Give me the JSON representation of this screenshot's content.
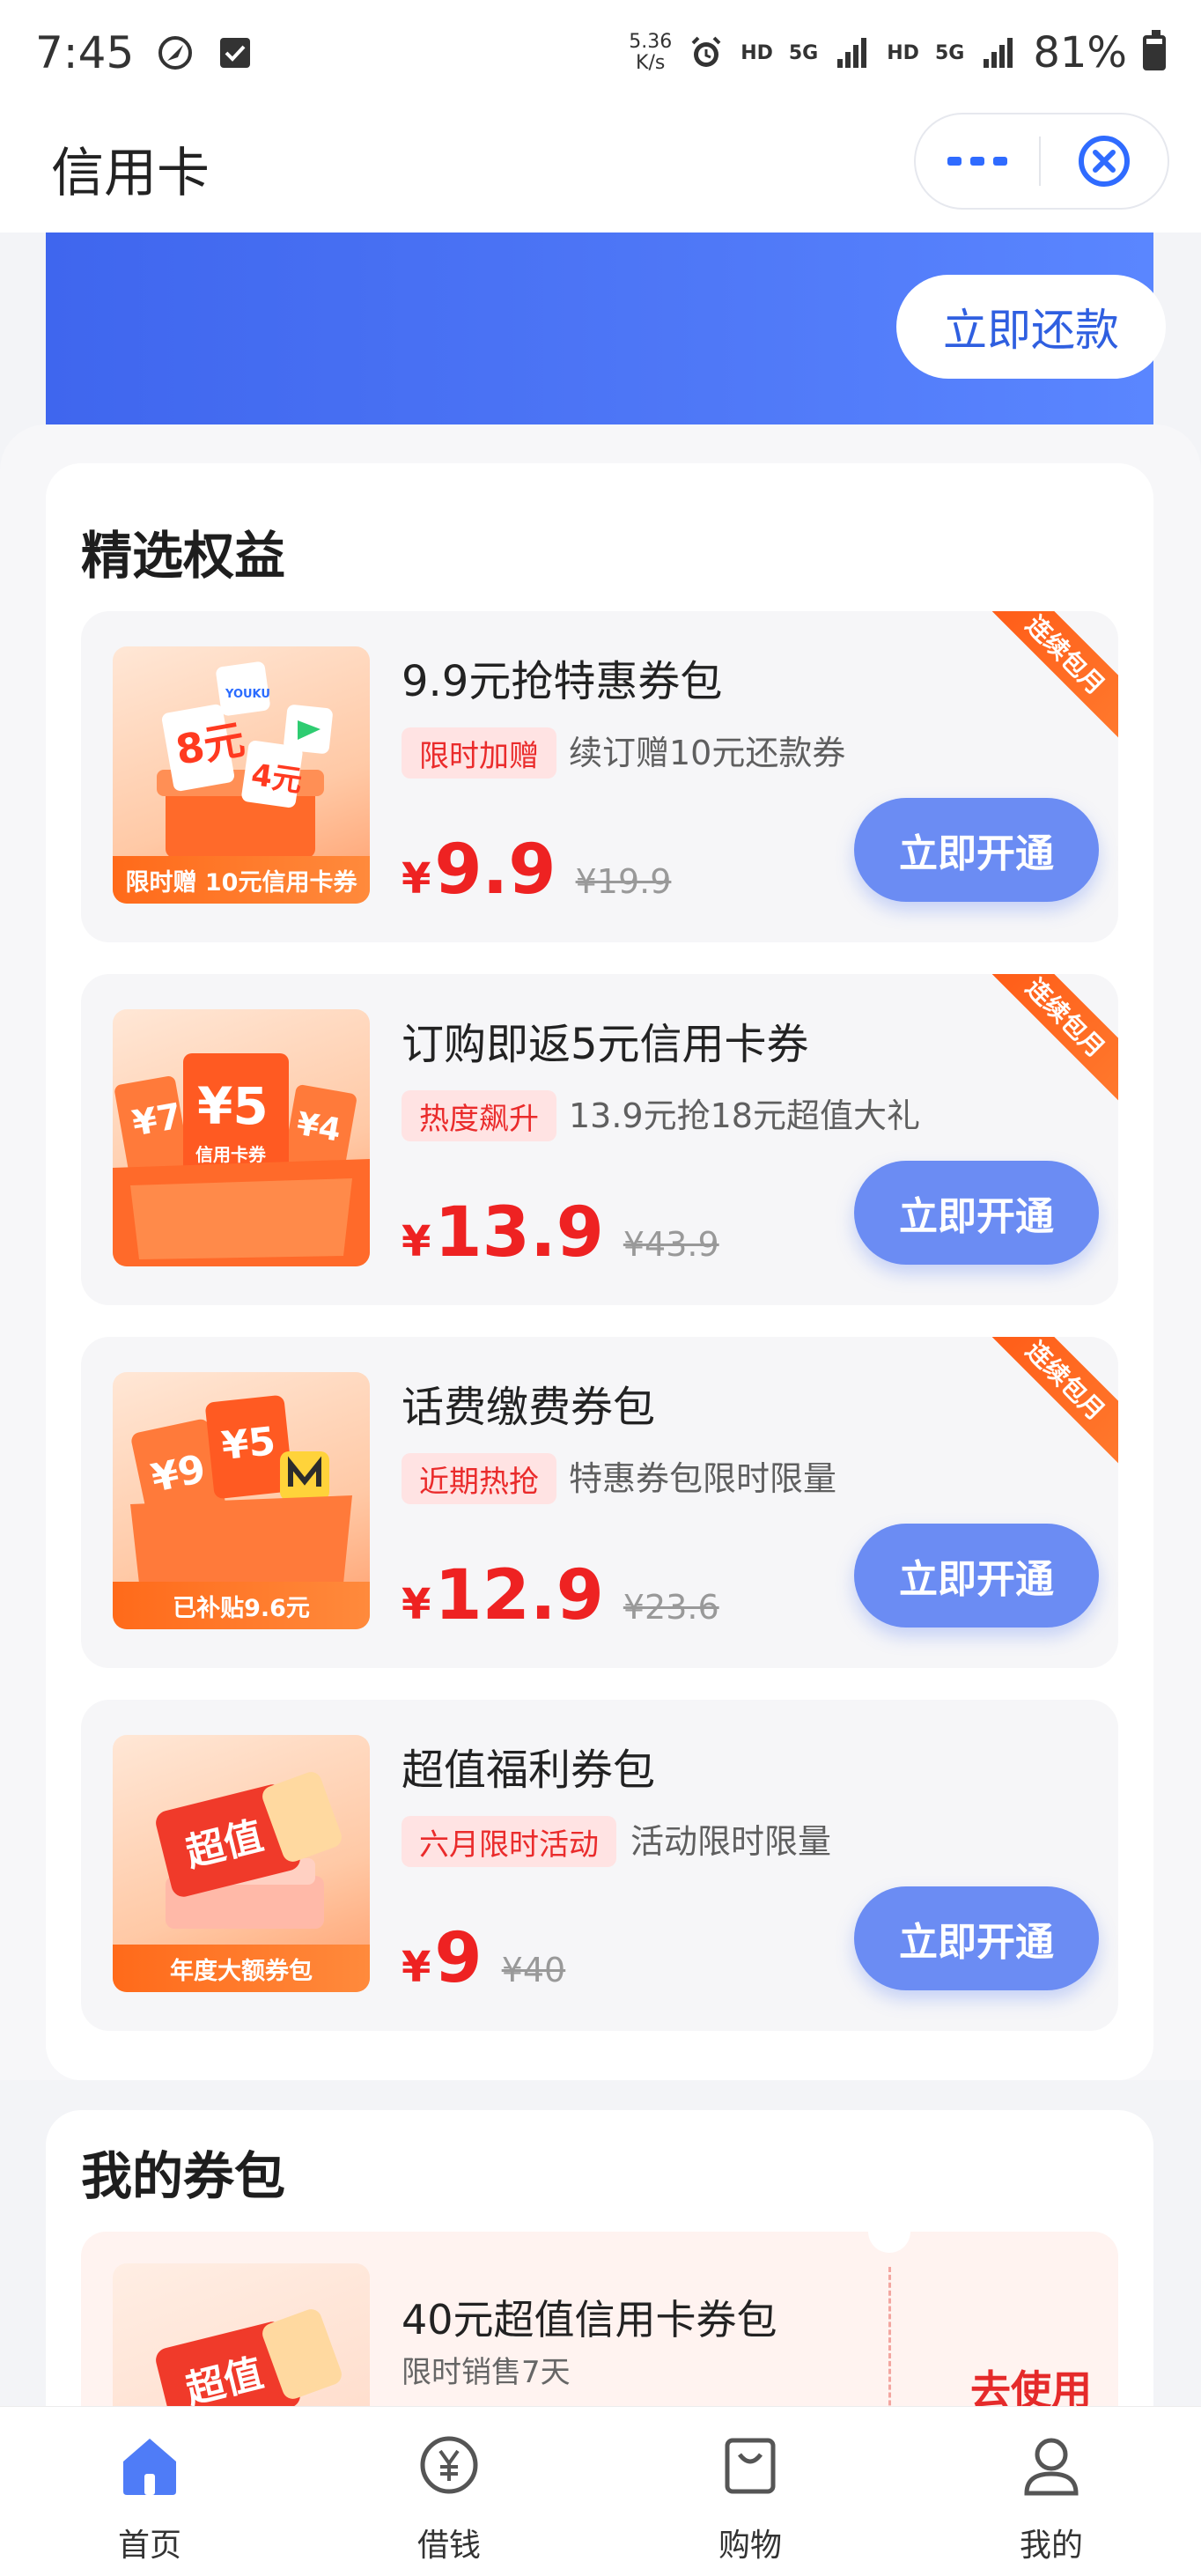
{
  "status_bar": {
    "time": "7:45",
    "net_speed_value": "5.36",
    "net_speed_unit": "K/s",
    "hd1": "HD",
    "sig1": "5G",
    "hd2": "HD",
    "sig2": "5G",
    "battery": "81%"
  },
  "header": {
    "title": "信用卡"
  },
  "banner": {
    "repay_label": "立即还款"
  },
  "benefits": {
    "title": "精选权益",
    "open_label": "立即开通",
    "ribbon_label": "连续包月",
    "items": [
      {
        "title": "9.9元抢特惠券包",
        "tag": "限时加赠",
        "desc": "续订赠10元还款券",
        "currency": "¥",
        "price": "9.9",
        "original": "¥19.9",
        "img_caption": "限时赠 10元信用卡券",
        "img_texts": [
          "8元",
          "4元",
          "YOUKU"
        ]
      },
      {
        "title": "订购即返5元信用卡券",
        "tag": "热度飙升",
        "desc": "13.9元抢18元超值大礼",
        "currency": "¥",
        "price": "13.9",
        "original": "¥43.9",
        "img_texts": [
          "¥7",
          "¥5",
          "¥4",
          "信用卡券"
        ]
      },
      {
        "title": "话费缴费券包",
        "tag": "近期热抢",
        "desc": "特惠券包限时限量",
        "currency": "¥",
        "price": "12.9",
        "original": "¥23.6",
        "img_caption": "已补贴9.6元",
        "img_texts": [
          "¥9",
          "¥5"
        ]
      },
      {
        "title": "超值福利券包",
        "tag": "六月限时活动",
        "desc": "活动限时限量",
        "currency": "¥",
        "price": "9",
        "original": "¥40",
        "img_caption": "年度大额券包",
        "img_texts": [
          "超值"
        ]
      }
    ]
  },
  "my_coupons": {
    "title": "我的券包",
    "card": {
      "title": "40元超值信用卡券包",
      "subtitle": "限时销售7天",
      "action": "去使用",
      "img_text": "超值"
    }
  },
  "tab_bar": {
    "items": [
      {
        "label": "首页",
        "icon": "home-icon",
        "active": true
      },
      {
        "label": "借钱",
        "icon": "yuan-circle-icon",
        "active": false
      },
      {
        "label": "购物",
        "icon": "shopping-bag-icon",
        "active": false
      },
      {
        "label": "我的",
        "icon": "user-icon",
        "active": false
      }
    ]
  },
  "colors": {
    "brand_blue": "#3f66ee",
    "button_blue": "#6b8cf3",
    "price_red": "#ee2222",
    "ribbon_orange": "#ff5a16",
    "tag_bg": "#ffe3e3"
  }
}
